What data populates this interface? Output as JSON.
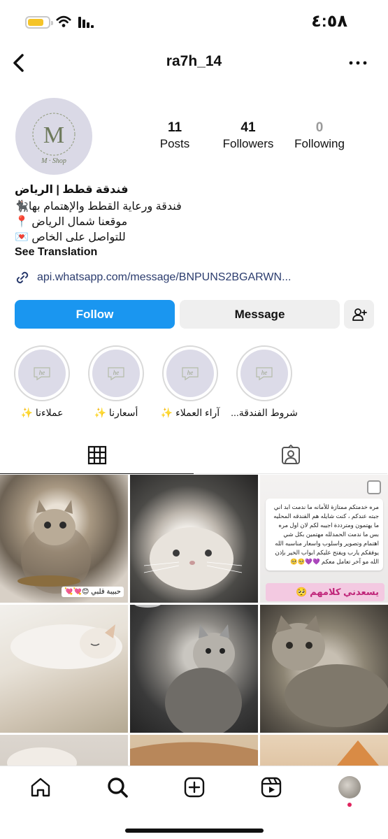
{
  "status_bar": {
    "time": "٤:٥٨"
  },
  "header": {
    "username": "ra7h_14"
  },
  "profile": {
    "avatar_logo_letter": "M",
    "avatar_logo_text": "M · Shop",
    "stats": [
      {
        "value": "11",
        "label": "Posts"
      },
      {
        "value": "41",
        "label": "Followers"
      },
      {
        "value": "0",
        "label": "Following"
      }
    ],
    "bio": {
      "name": "فندقة قطط | الرياض",
      "line1": "فندقة ورعاية القطط والإهتمام بها🐈‍⬛",
      "line2": "موقعنا شمال الرياض 📍",
      "line3": "للتواصل على الخاص 💌"
    },
    "see_translation": "See Translation",
    "link": "api.whatsapp.com/message/BNPUNS2BGARWN..."
  },
  "actions": {
    "follow": "Follow",
    "message": "Message"
  },
  "highlights": [
    {
      "label": "شروط الفندقة..."
    },
    {
      "label": "آراء العملاء ✨"
    },
    {
      "label": "أسعارنا ✨"
    },
    {
      "label": "عملاءنا ✨"
    }
  ],
  "grid": {
    "cell1_caption": "حبيبة قلبي 😊💘💘",
    "cell3_review": "مره خدمتكم ممتازة للأمانه ما ندمت ابد اني جبته عندكم ، كنت شايله هم الفندقه المحليه ما يهتمون ومترددة اجيبه لكم لان اول مره بس ما ندمت الحمدلله مهتمين بكل شي اهتمام وتصوير واسلوب واسعار مناسبه الله يوفقكم يارب ويفتح عليكم ابواب الخير بإذن الله مو آخر تعامل معكم 💜💜🥺🥺",
    "cell3_strip": "يسعدني كلامهم 🥺"
  },
  "colors": {
    "accent": "#1a96f0",
    "link": "#2b3c6e",
    "notification": "#e0245e"
  }
}
